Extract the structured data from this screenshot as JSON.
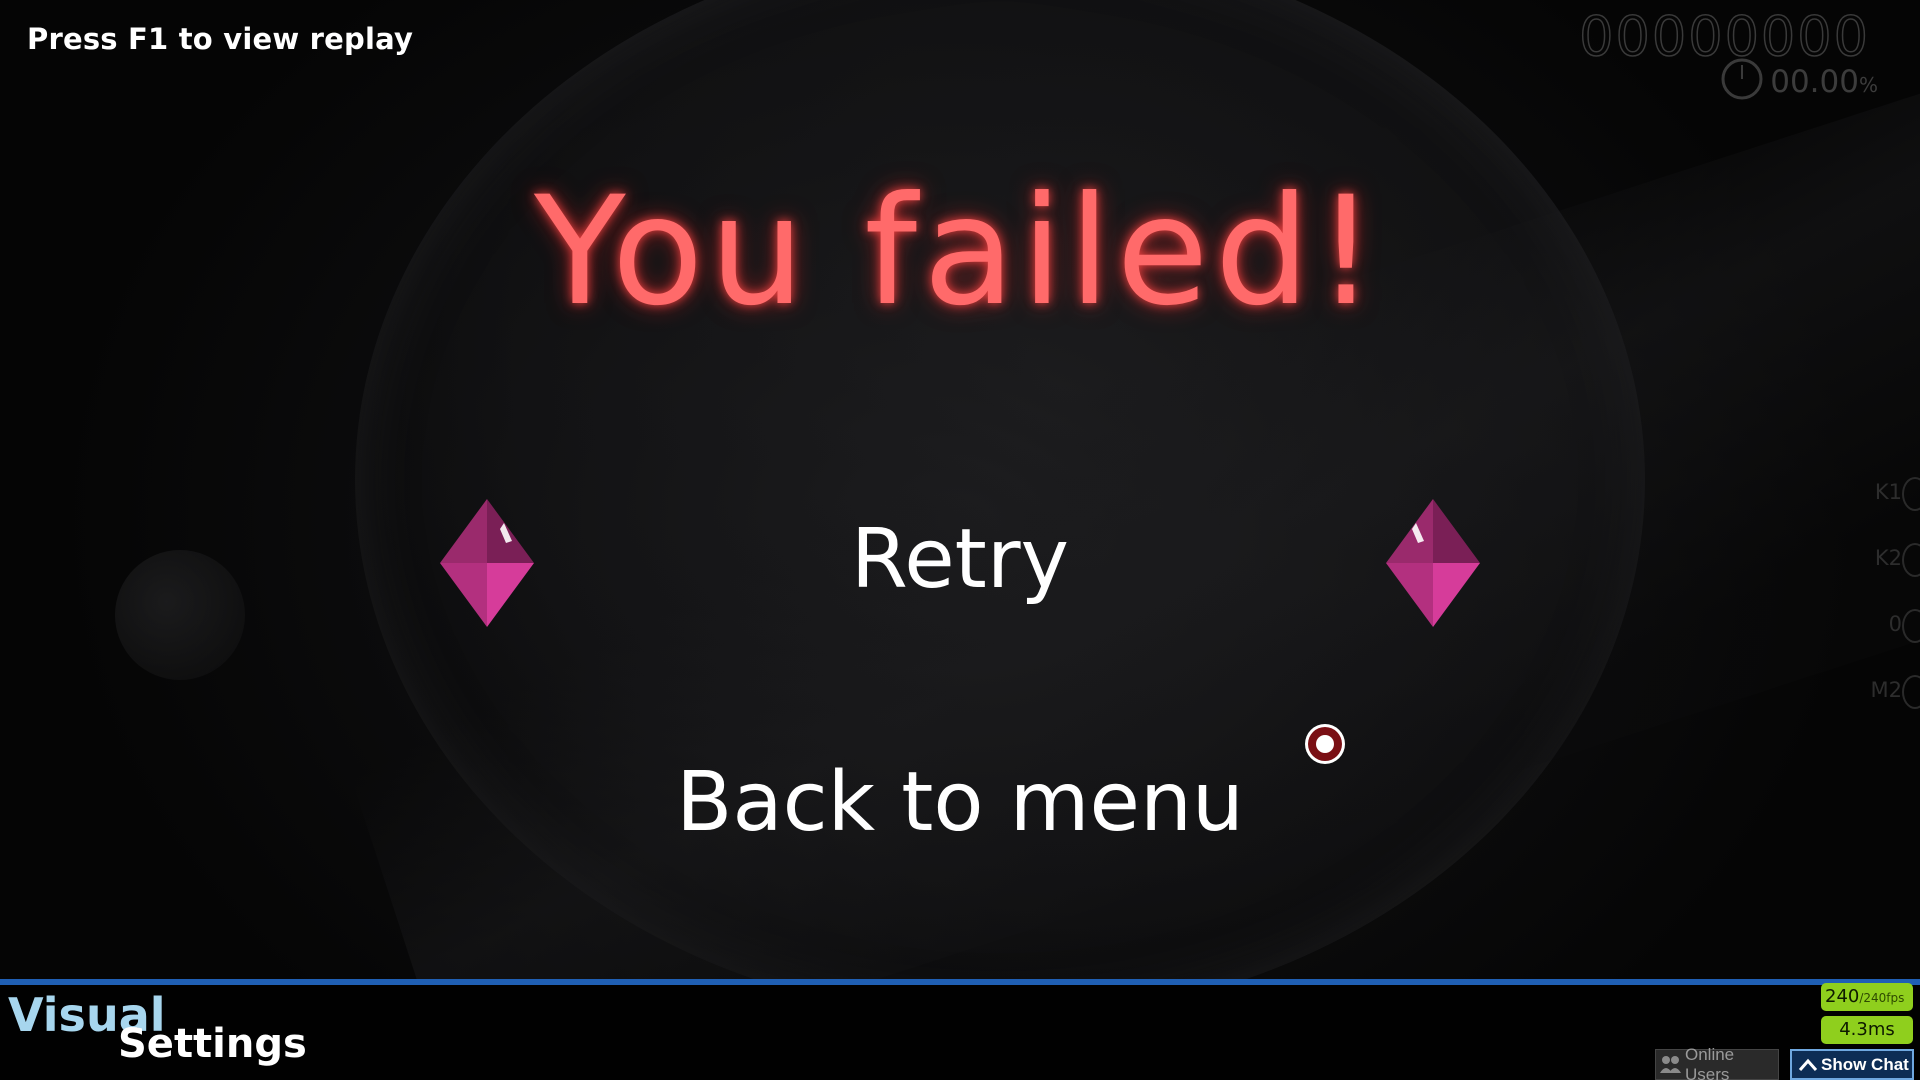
{
  "hud": {
    "replay_hint": "Press F1 to view replay",
    "score": "00000000",
    "accuracy_value": "00.00",
    "accuracy_unit": "%"
  },
  "fail_screen": {
    "title": "You failed!",
    "retry_label": "Retry",
    "back_label": "Back to menu"
  },
  "key_overlay": [
    {
      "label": "K1"
    },
    {
      "label": "K2"
    },
    {
      "label": "0"
    },
    {
      "label": "M2"
    }
  ],
  "bottom_bar": {
    "visual_label": "Visual",
    "settings_label": "Settings",
    "fps_value": "240",
    "fps_target": "/240fps",
    "frame_time": "4.3ms",
    "online_users_label": "Online Users",
    "show_chat_label": "Show Chat"
  },
  "colors": {
    "title_red": "#ff6a6a",
    "gem_pink": "#d63c9a",
    "accent_blue": "#1f5fb4",
    "fps_green": "#8fcf1d"
  },
  "icons": {
    "clock": "clock-icon",
    "gem": "gem-icon",
    "cursor": "cursor-icon",
    "users": "users-icon",
    "chevron": "chevron-up-icon"
  }
}
